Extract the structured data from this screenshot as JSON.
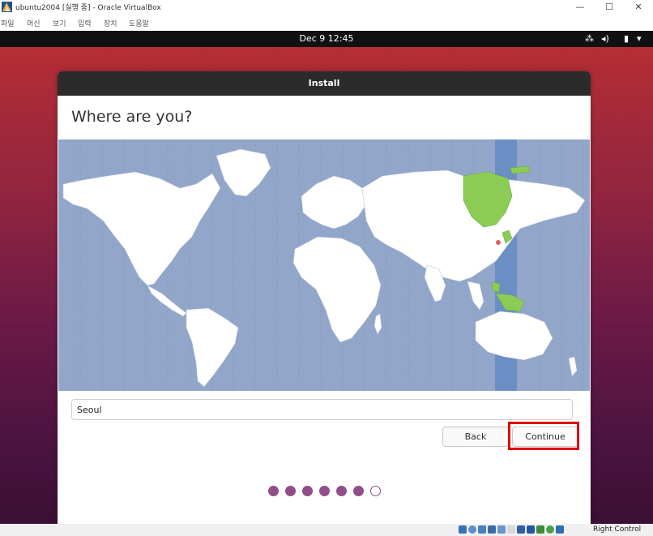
{
  "host_window": {
    "title": "ubuntu2004 [실행 중] - Oracle VirtualBox",
    "app_icon": "virtualbox-icon",
    "controls": {
      "minimize": "—",
      "maximize": "☐",
      "close": "✕"
    }
  },
  "menu": {
    "items": [
      {
        "label": "파일"
      },
      {
        "label": "머신"
      },
      {
        "label": "보기"
      },
      {
        "label": "입력"
      },
      {
        "label": "장치"
      },
      {
        "label": "도움말"
      }
    ]
  },
  "guest_topbar": {
    "clock": "Dec 9  12:45",
    "tray": {
      "network": "⁂",
      "volume": "◂)",
      "battery": "▮",
      "menu": "▾"
    }
  },
  "installer": {
    "window_title": "Install",
    "heading": "Where are you?",
    "map": {
      "selected_city": "Seoul",
      "highlight_color": "#8ccc55",
      "timezone_band_color": "#6b8fc5",
      "ocean_color": "#92a6c9"
    },
    "timezone_input": {
      "value": "Seoul"
    },
    "buttons": {
      "back": "Back",
      "continue": "Continue"
    },
    "progress": {
      "completed_steps": 6,
      "total_steps": 7
    }
  },
  "status_bar": {
    "host_key_label": "Right Control",
    "icons": [
      "hard-disk-icon",
      "optical-drive-icon",
      "audio-icon",
      "network-icon",
      "usb-icon",
      "shared-folder-icon",
      "display-icon",
      "recording-icon",
      "cpu-icon",
      "mouse-integration-icon",
      "keyboard-icon"
    ]
  }
}
